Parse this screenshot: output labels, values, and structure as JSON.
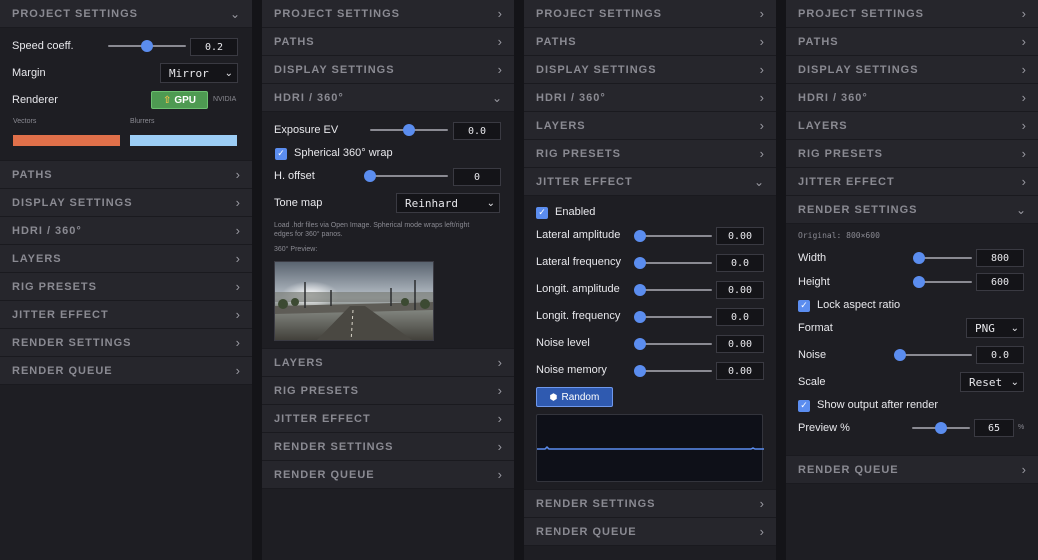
{
  "sections": {
    "project_settings": "PROJECT SETTINGS",
    "paths": "PATHS",
    "display_settings": "DISPLAY SETTINGS",
    "hdri": "HDRI / 360°",
    "layers": "LAYERS",
    "rig_presets": "RIG PRESETS",
    "jitter_effect": "JITTER EFFECT",
    "render_settings": "RENDER SETTINGS",
    "render_queue": "RENDER QUEUE"
  },
  "icons": {
    "chevron_right": "›",
    "chevron_down": "⌄",
    "check": "✓",
    "caret": "⌄",
    "upload": "⇧",
    "dice": "⬢"
  },
  "colors": {
    "accent": "#5b8def",
    "vectors": "#e0704a",
    "blurrers": "#9ccdf5",
    "gpu": "#4e9a52"
  },
  "project": {
    "speed_label": "Speed coeff.",
    "speed_value": "0.2",
    "speed_fraction": 0.5,
    "margin_label": "Margin",
    "margin_value": "Mirror",
    "renderer_label": "Renderer",
    "gpu_label": "GPU",
    "gpu_vendor": "NVIDIA",
    "vectors_label": "Vectors",
    "blurrers_label": "Blurrers"
  },
  "hdri": {
    "exposure_label": "Exposure EV",
    "exposure_value": "0.0",
    "exposure_fraction": 0.5,
    "spherical_label": "Spherical 360° wrap",
    "spherical_checked": true,
    "hoffset_label": "H. offset",
    "hoffset_value": "0",
    "hoffset_fraction": 0.0,
    "tonemap_label": "Tone map",
    "tonemap_value": "Reinhard",
    "help_text": "Load .hdr files via Open Image. Spherical mode wraps left/right edges for 360° panos.",
    "preview_label": "360° Preview:"
  },
  "jitter": {
    "enabled_label": "Enabled",
    "enabled_checked": true,
    "rows": [
      {
        "label": "Lateral amplitude",
        "value": "0.00",
        "fraction": 0.0
      },
      {
        "label": "Lateral frequency",
        "value": "0.0",
        "fraction": 0.0
      },
      {
        "label": "Longit. amplitude",
        "value": "0.00",
        "fraction": 0.0
      },
      {
        "label": "Longit. frequency",
        "value": "0.0",
        "fraction": 0.0
      },
      {
        "label": "Noise level",
        "value": "0.00",
        "fraction": 0.0
      },
      {
        "label": "Noise memory",
        "value": "0.00",
        "fraction": 0.0
      }
    ],
    "random_label": "Random"
  },
  "render": {
    "original": "Original: 800×600",
    "width_label": "Width",
    "width_value": "800",
    "width_fraction": 0.05,
    "height_label": "Height",
    "height_value": "600",
    "height_fraction": 0.05,
    "lock_label": "Lock aspect ratio",
    "lock_checked": true,
    "format_label": "Format",
    "format_value": "PNG",
    "noise_label": "Noise",
    "noise_value": "0.0",
    "noise_fraction": 0.0,
    "scale_label": "Scale",
    "scale_value": "Reset",
    "show_label": "Show output after render",
    "show_checked": true,
    "preview_label": "Preview %",
    "preview_value": "65",
    "preview_fraction": 0.5,
    "preview_unit": "%"
  }
}
